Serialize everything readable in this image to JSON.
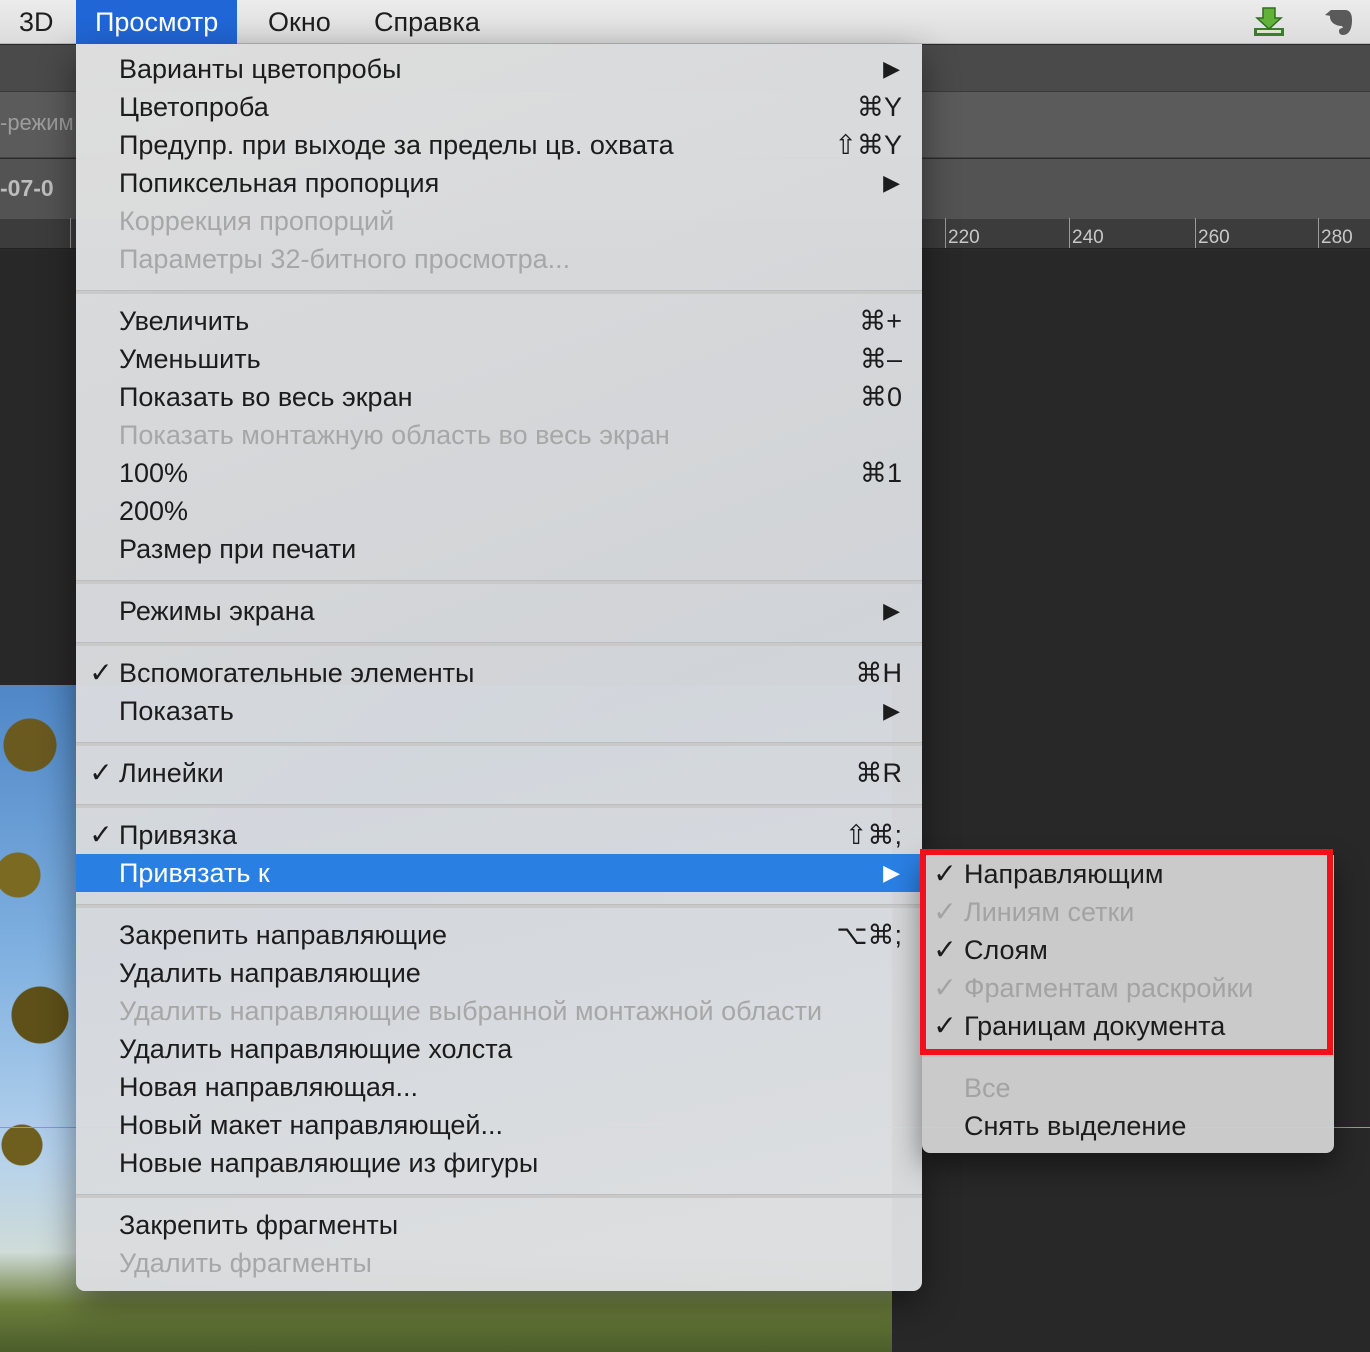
{
  "menubar": {
    "items": [
      "3D",
      "Просмотр",
      "Окно",
      "Справка"
    ],
    "active_index": 1,
    "tray_icons": [
      "download-arrow-icon",
      "evernote-elephant-icon"
    ]
  },
  "background": {
    "panel_text_1": "-режим",
    "panel_text_2": "-07-0",
    "ruler_labels": [
      "220",
      "240",
      "260",
      "280"
    ]
  },
  "menu": {
    "items": [
      {
        "label": "Варианты цветопробы",
        "shortcut": "",
        "submenu": true,
        "checked": false,
        "disabled": false
      },
      {
        "label": "Цветопроба",
        "shortcut": "⌘Y",
        "submenu": false,
        "checked": false,
        "disabled": false
      },
      {
        "label": "Предупр. при выходе за пределы цв. охвата",
        "shortcut": "⇧⌘Y",
        "submenu": false,
        "checked": false,
        "disabled": false
      },
      {
        "label": "Попиксельная пропорция",
        "shortcut": "",
        "submenu": true,
        "checked": false,
        "disabled": false
      },
      {
        "label": "Коррекция пропорций",
        "shortcut": "",
        "submenu": false,
        "checked": false,
        "disabled": true
      },
      {
        "label": "Параметры 32-битного просмотра...",
        "shortcut": "",
        "submenu": false,
        "checked": false,
        "disabled": true
      },
      {
        "label": "Увеличить",
        "shortcut": "⌘+",
        "submenu": false,
        "checked": false,
        "disabled": false
      },
      {
        "label": "Уменьшить",
        "shortcut": "⌘–",
        "submenu": false,
        "checked": false,
        "disabled": false
      },
      {
        "label": "Показать во весь экран",
        "shortcut": "⌘0",
        "submenu": false,
        "checked": false,
        "disabled": false
      },
      {
        "label": "Показать монтажную область во весь экран",
        "shortcut": "",
        "submenu": false,
        "checked": false,
        "disabled": true
      },
      {
        "label": "100%",
        "shortcut": "⌘1",
        "submenu": false,
        "checked": false,
        "disabled": false
      },
      {
        "label": "200%",
        "shortcut": "",
        "submenu": false,
        "checked": false,
        "disabled": false
      },
      {
        "label": "Размер при печати",
        "shortcut": "",
        "submenu": false,
        "checked": false,
        "disabled": false
      },
      {
        "label": "Режимы экрана",
        "shortcut": "",
        "submenu": true,
        "checked": false,
        "disabled": false
      },
      {
        "label": "Вспомогательные элементы",
        "shortcut": "⌘H",
        "submenu": false,
        "checked": true,
        "disabled": false
      },
      {
        "label": "Показать",
        "shortcut": "",
        "submenu": true,
        "checked": false,
        "disabled": false
      },
      {
        "label": "Линейки",
        "shortcut": "⌘R",
        "submenu": false,
        "checked": true,
        "disabled": false
      },
      {
        "label": "Привязка",
        "shortcut": "⇧⌘;",
        "submenu": false,
        "checked": true,
        "disabled": false
      },
      {
        "label": "Привязать к",
        "shortcut": "",
        "submenu": true,
        "checked": false,
        "disabled": false,
        "highlighted": true
      },
      {
        "label": "Закрепить направляющие",
        "shortcut": "⌥⌘;",
        "submenu": false,
        "checked": false,
        "disabled": false
      },
      {
        "label": "Удалить направляющие",
        "shortcut": "",
        "submenu": false,
        "checked": false,
        "disabled": false
      },
      {
        "label": "Удалить направляющие выбранной монтажной области",
        "shortcut": "",
        "submenu": false,
        "checked": false,
        "disabled": true
      },
      {
        "label": "Удалить направляющие холста",
        "shortcut": "",
        "submenu": false,
        "checked": false,
        "disabled": false
      },
      {
        "label": "Новая направляющая...",
        "shortcut": "",
        "submenu": false,
        "checked": false,
        "disabled": false
      },
      {
        "label": "Новый макет направляющей...",
        "shortcut": "",
        "submenu": false,
        "checked": false,
        "disabled": false
      },
      {
        "label": "Новые направляющие из фигуры",
        "shortcut": "",
        "submenu": false,
        "checked": false,
        "disabled": false
      },
      {
        "label": "Закрепить фрагменты",
        "shortcut": "",
        "submenu": false,
        "checked": false,
        "disabled": false
      },
      {
        "label": "Удалить фрагменты",
        "shortcut": "",
        "submenu": false,
        "checked": false,
        "disabled": true
      }
    ]
  },
  "submenu": {
    "items": [
      {
        "label": "Направляющим",
        "checked": true,
        "disabled": false
      },
      {
        "label": "Линиям сетки",
        "checked": true,
        "disabled": true
      },
      {
        "label": "Слоям",
        "checked": true,
        "disabled": false
      },
      {
        "label": "Фрагментам раскройки",
        "checked": true,
        "disabled": true
      },
      {
        "label": "Границам документа",
        "checked": true,
        "disabled": false
      },
      {
        "label": "Все",
        "checked": false,
        "disabled": true
      },
      {
        "label": "Снять выделение",
        "checked": false,
        "disabled": false
      }
    ],
    "highlight_color": "#f2111b"
  },
  "glyphs": {
    "check": "✓",
    "arrow": "▶"
  }
}
